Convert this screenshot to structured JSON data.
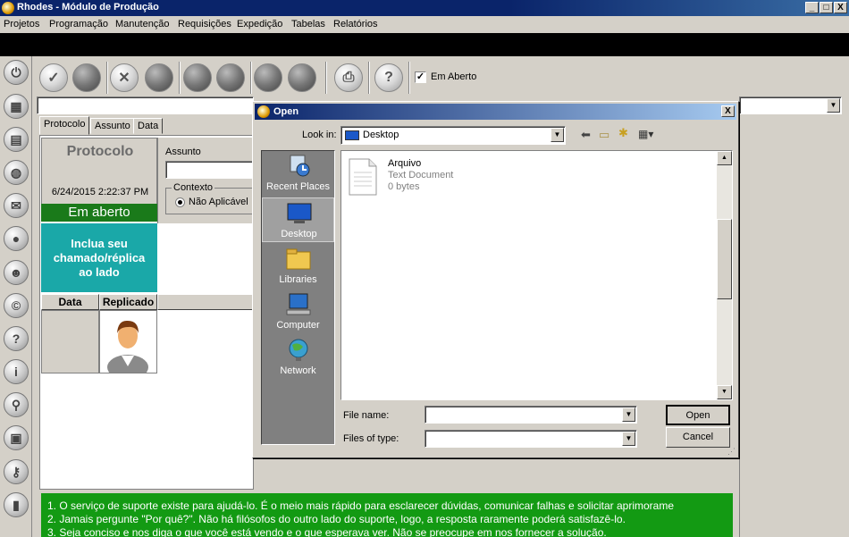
{
  "window": {
    "title": "Rhodes - Módulo de Produção",
    "minimize": "_",
    "maximize": "□",
    "close": "X"
  },
  "menu": [
    "Projetos",
    "Programação",
    "Manutenção",
    "Requisições",
    "Expedição",
    "Tabelas",
    "Relatórios"
  ],
  "toolbar": {
    "em_aberto_label": "Em Aberto",
    "em_aberto_checked": "✓",
    "question": "?"
  },
  "tabs": [
    "Protocolo",
    "Assunto",
    "Data"
  ],
  "protocolo": {
    "title": "Protocolo",
    "datetime": "6/24/2015 2:22:37 PM",
    "status": "Em aberto",
    "include_text": "Inclua seu chamado/réplica ao lado"
  },
  "assunto": {
    "label": "Assunto",
    "value": ""
  },
  "contexto": {
    "label": "Contexto",
    "option": "Não Aplicável"
  },
  "grid": {
    "columns": [
      "Data",
      "Replicado"
    ]
  },
  "messages": [
    "1. O serviço de suporte existe para ajudá-lo. É o meio mais rápido para esclarecer dúvidas, comunicar falhas e solicitar aprimorame",
    "2. Jamais pergunte \"Por quê?\". Não há filósofos do outro lado do suporte, logo, a resposta raramente poderá satisfazê-lo.",
    "3. Seja conciso e nos diga o que você está vendo e o que esperava ver. Não se preocupe em nos fornecer a solução."
  ],
  "dialog": {
    "title": "Open",
    "close": "X",
    "look_in_label": "Look in:",
    "look_in_value": "Desktop",
    "places": [
      "Recent Places",
      "Desktop",
      "Libraries",
      "Computer",
      "Network"
    ],
    "files": [
      {
        "name": "Arquivo",
        "type": "Text Document",
        "size": "0 bytes"
      }
    ],
    "file_name_label": "File name:",
    "file_name_value": "",
    "files_of_type_label": "Files of type:",
    "files_of_type_value": "",
    "open_button": "Open",
    "cancel_button": "Cancel"
  }
}
